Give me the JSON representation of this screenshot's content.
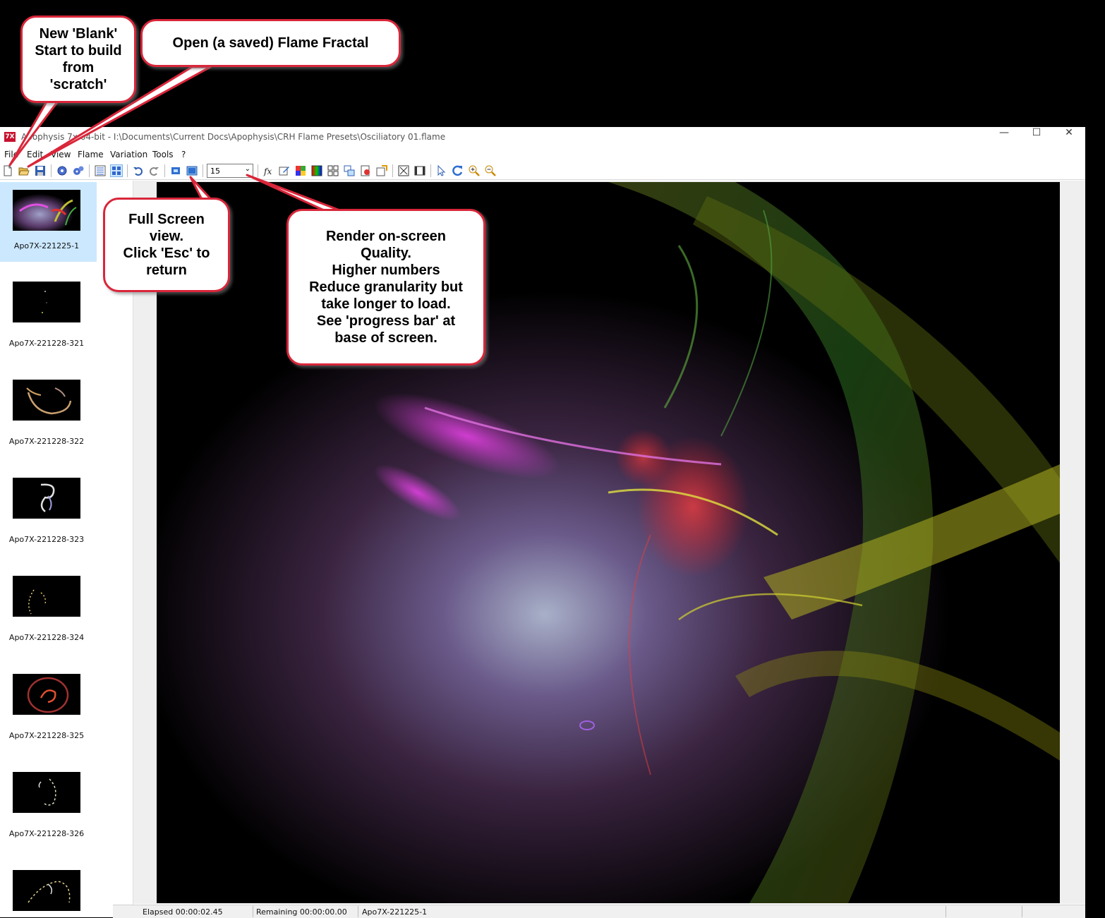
{
  "window": {
    "app_icon": "7X",
    "title": "Apophysis 7x 64-bit - I:\\Documents\\Current Docs\\Apophysis\\CRH Flame Presets\\Osciliatory 01.flame",
    "controls": {
      "minimize": "—",
      "maximize": "☐",
      "close": "✕"
    }
  },
  "menu": [
    "File",
    "Edit",
    "View",
    "Flame",
    "Variation",
    "Tools",
    "?"
  ],
  "toolbar": {
    "icons": [
      "new-icon",
      "open-icon",
      "save-icon",
      "gear-icon",
      "gears-icon",
      "list-view-icon",
      "icon-view-icon",
      "undo-icon",
      "redo-icon",
      "fullscreen-icon",
      "preview-icon",
      "formula-icon",
      "editor-icon",
      "palette-icon",
      "gradient-icon",
      "mutate-icon",
      "adjust-icon",
      "render-icon",
      "script-icon",
      "options-icon",
      "canvas-icon",
      "film-icon",
      "select-icon",
      "rotate-icon",
      "zoom-in-icon",
      "zoom-out-icon"
    ],
    "quality_value": "15"
  },
  "thumbnails": [
    {
      "label": "Apo7X-221225-1",
      "selected": true
    },
    {
      "label": "Apo7X-221228-321"
    },
    {
      "label": "Apo7X-221228-322"
    },
    {
      "label": "Apo7X-221228-323"
    },
    {
      "label": "Apo7X-221228-324"
    },
    {
      "label": "Apo7X-221228-325"
    },
    {
      "label": "Apo7X-221228-326"
    },
    {
      "label": ""
    }
  ],
  "status": {
    "elapsed": "Elapsed 00:00:02.45",
    "remaining": "Remaining 00:00:00.00",
    "flame_name": "Apo7X-221225-1"
  },
  "callouts": {
    "new_blank": "New 'Blank'\nStart to build\nfrom\n'scratch'",
    "open_saved": "Open (a saved) Flame Fractal",
    "full_screen": "Full Screen\nview.\nClick 'Esc' to\nreturn",
    "render_quality": "Render on-screen\nQuality.\nHigher numbers\nReduce granularity but\ntake longer to load.\nSee 'progress bar' at\nbase of screen."
  },
  "colors": {
    "callout_border": "#d9263a",
    "selection": "#cce8ff",
    "background": "#000000"
  }
}
